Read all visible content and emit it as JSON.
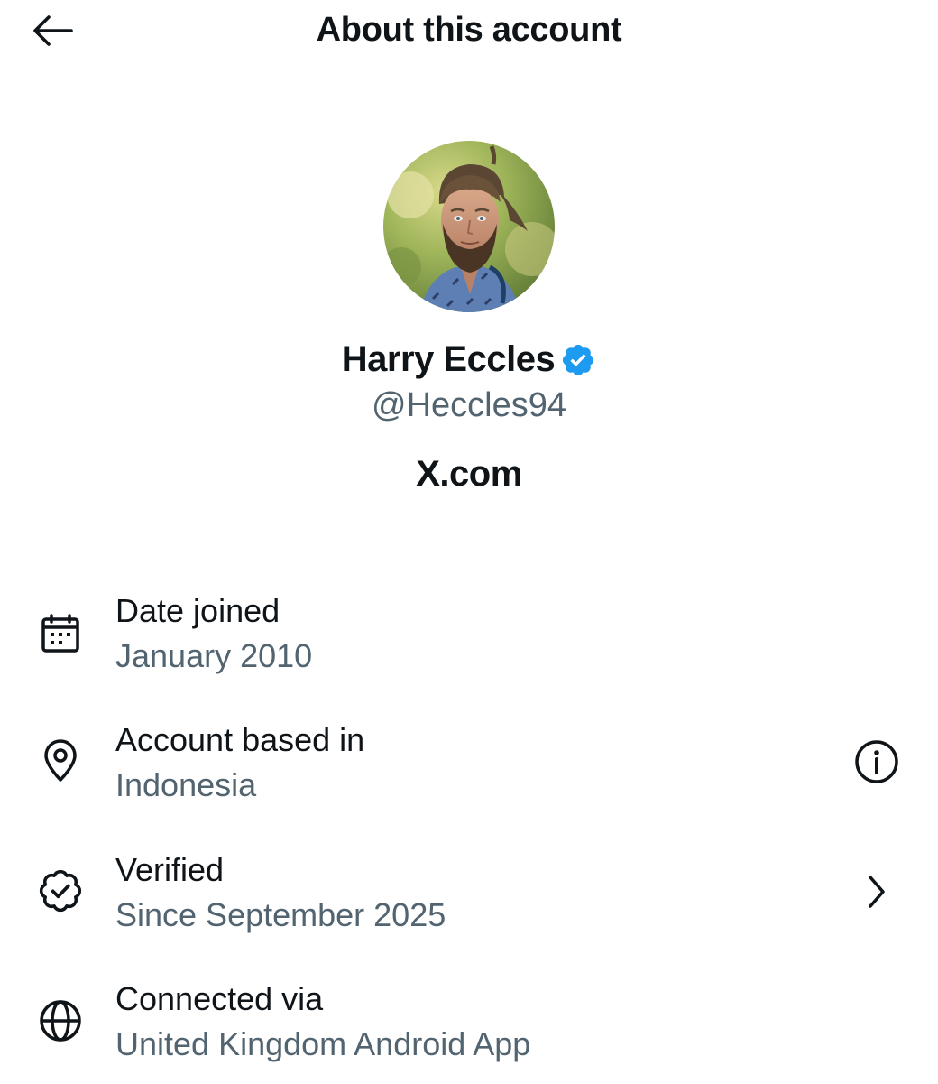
{
  "header": {
    "title": "About this account",
    "back_icon": "arrow-left-icon"
  },
  "profile": {
    "name": "Harry Eccles",
    "handle": "@Heccles94",
    "verified": true,
    "badge_color": "#1d9bf0",
    "domain": "X.com"
  },
  "details": [
    {
      "label": "Date joined",
      "value": "January 2010",
      "icon": "calendar-icon",
      "trailing": null
    },
    {
      "label": "Account based in",
      "value": "Indonesia",
      "icon": "location-pin-icon",
      "trailing": "info-icon"
    },
    {
      "label": "Verified",
      "value": "Since September 2025",
      "icon": "verified-badge-icon",
      "trailing": "chevron-right-icon"
    },
    {
      "label": "Connected via",
      "value": "United Kingdom Android App",
      "icon": "globe-icon",
      "trailing": null
    }
  ],
  "colors": {
    "primary_text": "#0f1419",
    "secondary_text": "#536471",
    "background": "#ffffff"
  }
}
